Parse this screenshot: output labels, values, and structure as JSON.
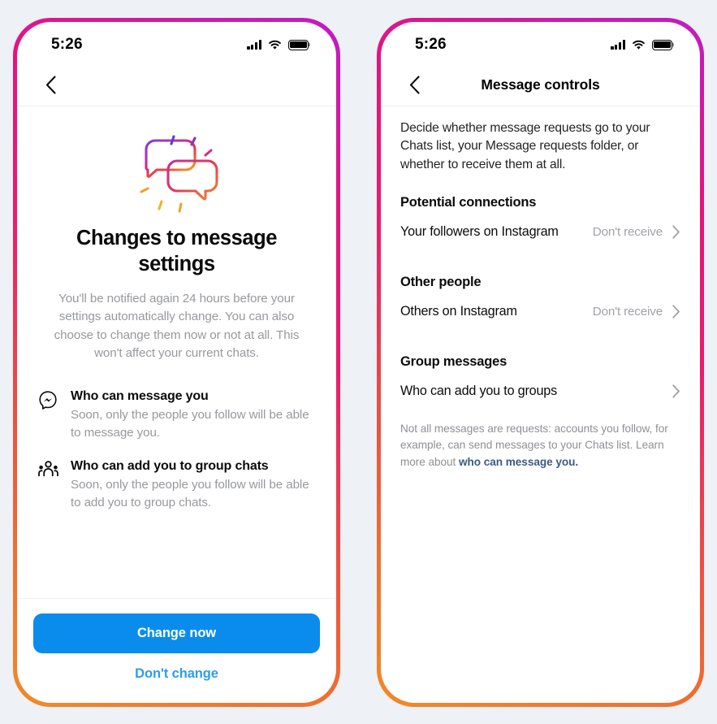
{
  "theme": {
    "page_background": "#eef1f5",
    "frame_gradient_start": "#c01cc6",
    "frame_gradient_mid": "#ec1a6e",
    "frame_gradient_end": "#f08a2a",
    "primary_button": "#0a8ced",
    "link_blue": "#2d9cf0",
    "footnote_link": "#3b5a86",
    "muted_text": "#97999d"
  },
  "phone_left": {
    "status": {
      "time": "5:26",
      "signal_icon": "signal-bars-icon",
      "wifi_icon": "wifi-icon",
      "battery_icon": "battery-full-icon"
    },
    "nav": {
      "back_icon": "chevron-left-icon",
      "title": ""
    },
    "hero": {
      "illustration": "two-speech-bubbles-illustration",
      "title": "Changes to message settings",
      "subtitle": "You'll be notified again 24 hours before your settings automatically change. You can also choose to change them now or not at all. This won't affect your current chats."
    },
    "features": [
      {
        "icon": "messenger-bubble-icon",
        "title": "Who can message you",
        "description": "Soon, only the people you follow will be able to message you."
      },
      {
        "icon": "group-people-icon",
        "title": "Who can add you to group chats",
        "description": "Soon, only the people you follow will be able to add you to group chats."
      }
    ],
    "actions": {
      "primary_label": "Change now",
      "secondary_label": "Don't change"
    }
  },
  "phone_right": {
    "status": {
      "time": "5:26",
      "signal_icon": "signal-bars-icon",
      "wifi_icon": "wifi-icon",
      "battery_icon": "battery-full-icon"
    },
    "nav": {
      "back_icon": "chevron-left-icon",
      "title": "Message controls"
    },
    "intro": "Decide whether message requests go to your Chats list, your Message requests folder, or whether to receive them at all.",
    "sections": [
      {
        "heading": "Potential connections",
        "rows": [
          {
            "label": "Your followers on Instagram",
            "value": "Don't receive",
            "chevron": "chevron-right-icon"
          }
        ]
      },
      {
        "heading": "Other people",
        "rows": [
          {
            "label": "Others on Instagram",
            "value": "Don't receive",
            "chevron": "chevron-right-icon"
          }
        ]
      },
      {
        "heading": "Group messages",
        "rows": [
          {
            "label": "Who can add you to groups",
            "value": "",
            "chevron": "chevron-right-icon"
          }
        ]
      }
    ],
    "footnote": {
      "text": "Not all messages are requests: accounts you follow, for example, can send messages to your Chats list. Learn more about ",
      "link_text": "who can message you."
    }
  }
}
